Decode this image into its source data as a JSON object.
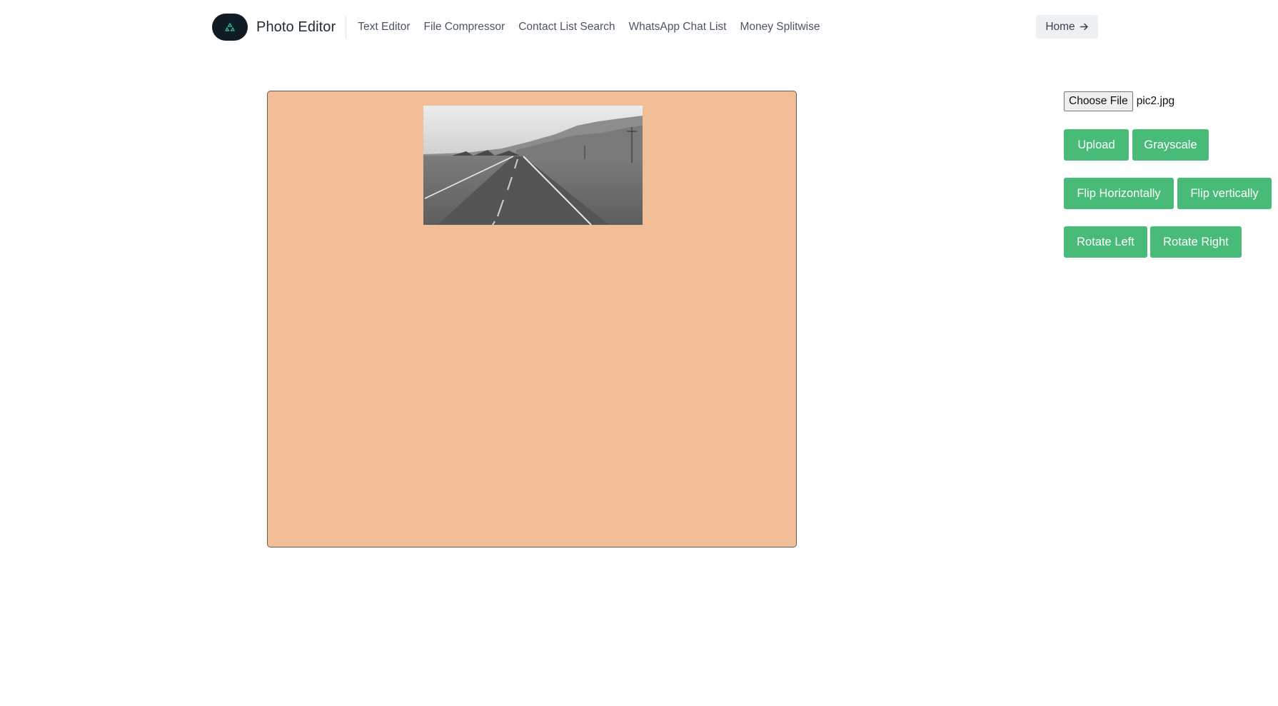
{
  "header": {
    "brand": "Photo Editor",
    "nav_links": [
      "Text Editor",
      "File Compressor",
      "Contact List Search",
      "WhatsApp Chat List",
      "Money Splitwise"
    ],
    "home_label": "Home",
    "home_icon": "arrow-right-icon",
    "logo_icon": "recycle-icon"
  },
  "editor": {
    "background_color": "#f1be97",
    "image_effect": "grayscale"
  },
  "controls": {
    "choose_file_label": "Choose File",
    "file_name": "pic2.jpg",
    "upload": "Upload",
    "grayscale": "Grayscale",
    "flip_horizontally": "Flip Horizontally",
    "flip_vertically": "Flip vertically",
    "rotate_left": "Rotate Left",
    "rotate_right": "Rotate Right",
    "accent_color": "#48bb78"
  }
}
